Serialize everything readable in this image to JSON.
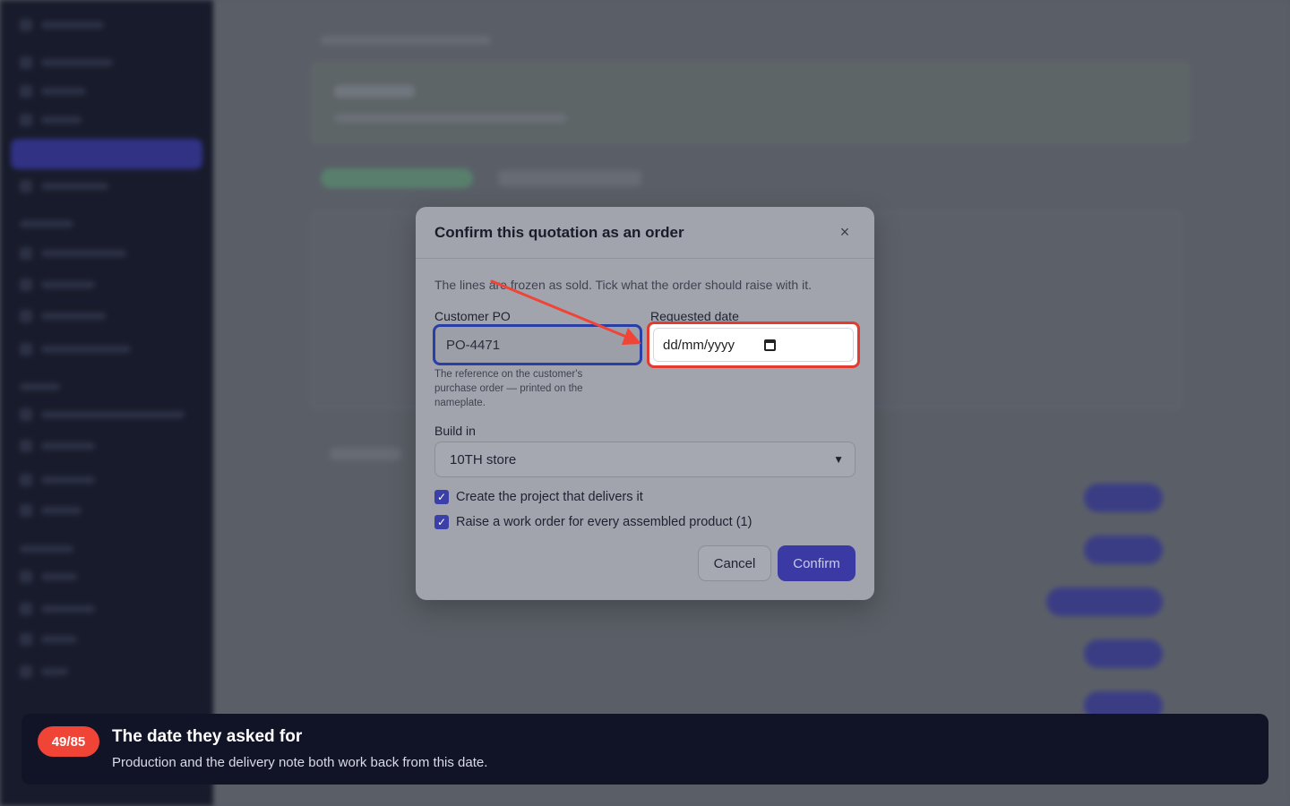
{
  "dialog": {
    "title": "Confirm this quotation as an order",
    "intro": "The lines are frozen as sold. Tick what the order should raise with it.",
    "customer_po": {
      "label": "Customer PO",
      "value": "PO-4471",
      "help": "The reference on the customer's purchase order — printed on the nameplate."
    },
    "requested_date": {
      "label": "Requested date",
      "placeholder": "dd/mm/yyyy"
    },
    "build_in": {
      "label": "Build in",
      "selected": "10TH store"
    },
    "checks": [
      {
        "label": "Create the project that delivers it",
        "checked": true
      },
      {
        "label": "Raise a work order for every assembled product (1)",
        "checked": true
      }
    ],
    "cancel_label": "Cancel",
    "confirm_label": "Confirm",
    "close_glyph": "×"
  },
  "tour": {
    "step": "49/85",
    "title": "The date they asked for",
    "description": "Production and the delivery note both work back from this date."
  },
  "colors": {
    "highlight": "#e23b2f",
    "accent": "#3b3aa4",
    "badge": "#f04437"
  }
}
